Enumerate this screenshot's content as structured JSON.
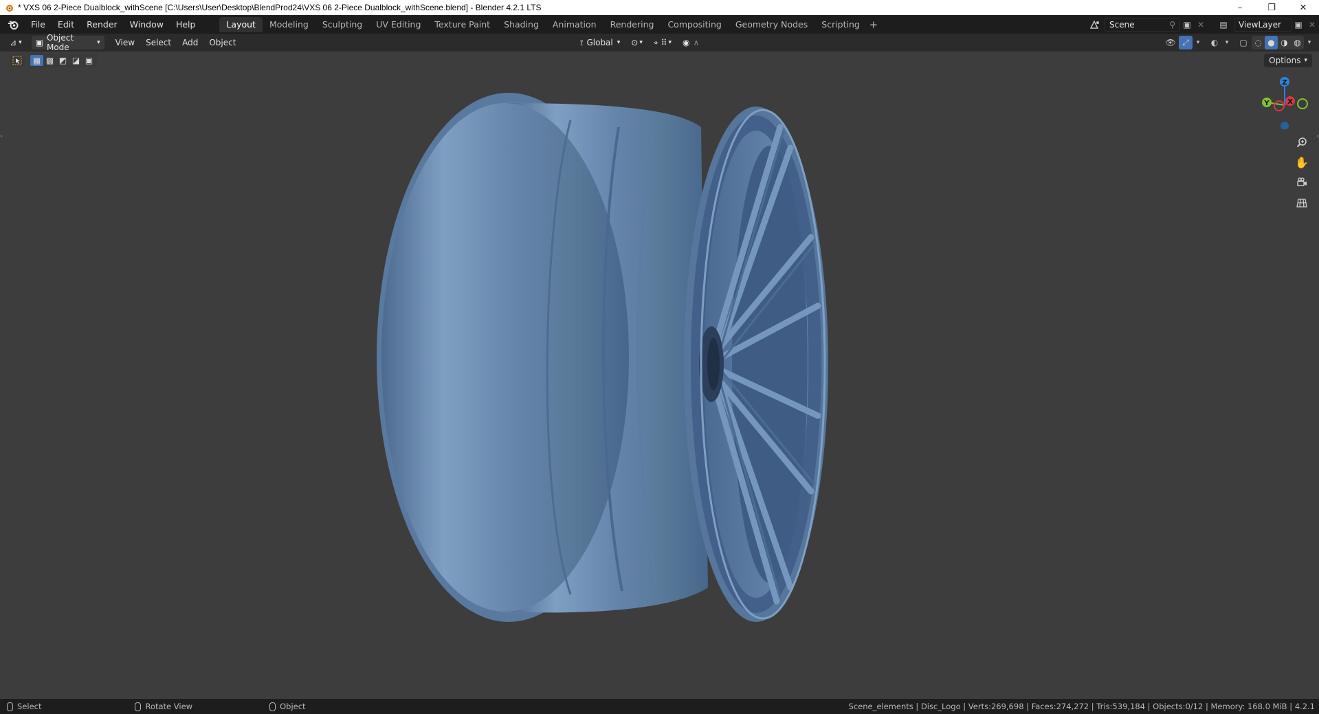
{
  "window": {
    "title": "* VXS 06 2-Piece Dualblock_withScene [C:\\Users\\User\\Desktop\\BlendProd24\\VXS 06 2-Piece Dualblock_withScene.blend] - Blender 4.2.1 LTS",
    "minimize": "–",
    "restore": "❐",
    "close": "✕"
  },
  "menu": [
    "File",
    "Edit",
    "Render",
    "Window",
    "Help"
  ],
  "workspaces": {
    "tabs": [
      "Layout",
      "Modeling",
      "Sculpting",
      "UV Editing",
      "Texture Paint",
      "Shading",
      "Animation",
      "Rendering",
      "Compositing",
      "Geometry Nodes",
      "Scripting"
    ],
    "active": "Layout",
    "add": "+"
  },
  "scene": {
    "name": "Scene",
    "view_layer": "ViewLayer"
  },
  "viewport_header": {
    "mode": "Object Mode",
    "menus": [
      "View",
      "Select",
      "Add",
      "Object"
    ],
    "transform_orientation": "Global"
  },
  "tool_settings": {
    "options_label": "Options"
  },
  "gizmo": {
    "z": "Z",
    "y": "Y",
    "x": "X"
  },
  "status": {
    "select": "Select",
    "rotate": "Rotate View",
    "object": "Object",
    "stats": "Scene_elements | Disc_Logo | Verts:269,698 | Faces:274,272 | Tris:539,184 | Objects:0/12 | Memory: 168.0 MiB | 4.2.1"
  },
  "colors": {
    "accent": "#4772b3",
    "wheel": "#5f7fa6",
    "background": "#3d3d3d",
    "axis_x": "#d2374a",
    "axis_y": "#82c12e",
    "axis_z": "#2f82dc"
  },
  "icons": [
    "blender-logo-icon",
    "editor-type-icon",
    "object-mode-icon",
    "orientation-icon",
    "pivot-icon",
    "snap-icon",
    "proportional-icon",
    "visibility-icon",
    "gizmo-icon",
    "overlay-icon",
    "xray-icon",
    "wireframe-icon",
    "solid-icon",
    "material-icon",
    "rendered-icon",
    "zoom-icon",
    "pan-icon",
    "camera-icon",
    "grid-icon",
    "select-box-icon"
  ]
}
